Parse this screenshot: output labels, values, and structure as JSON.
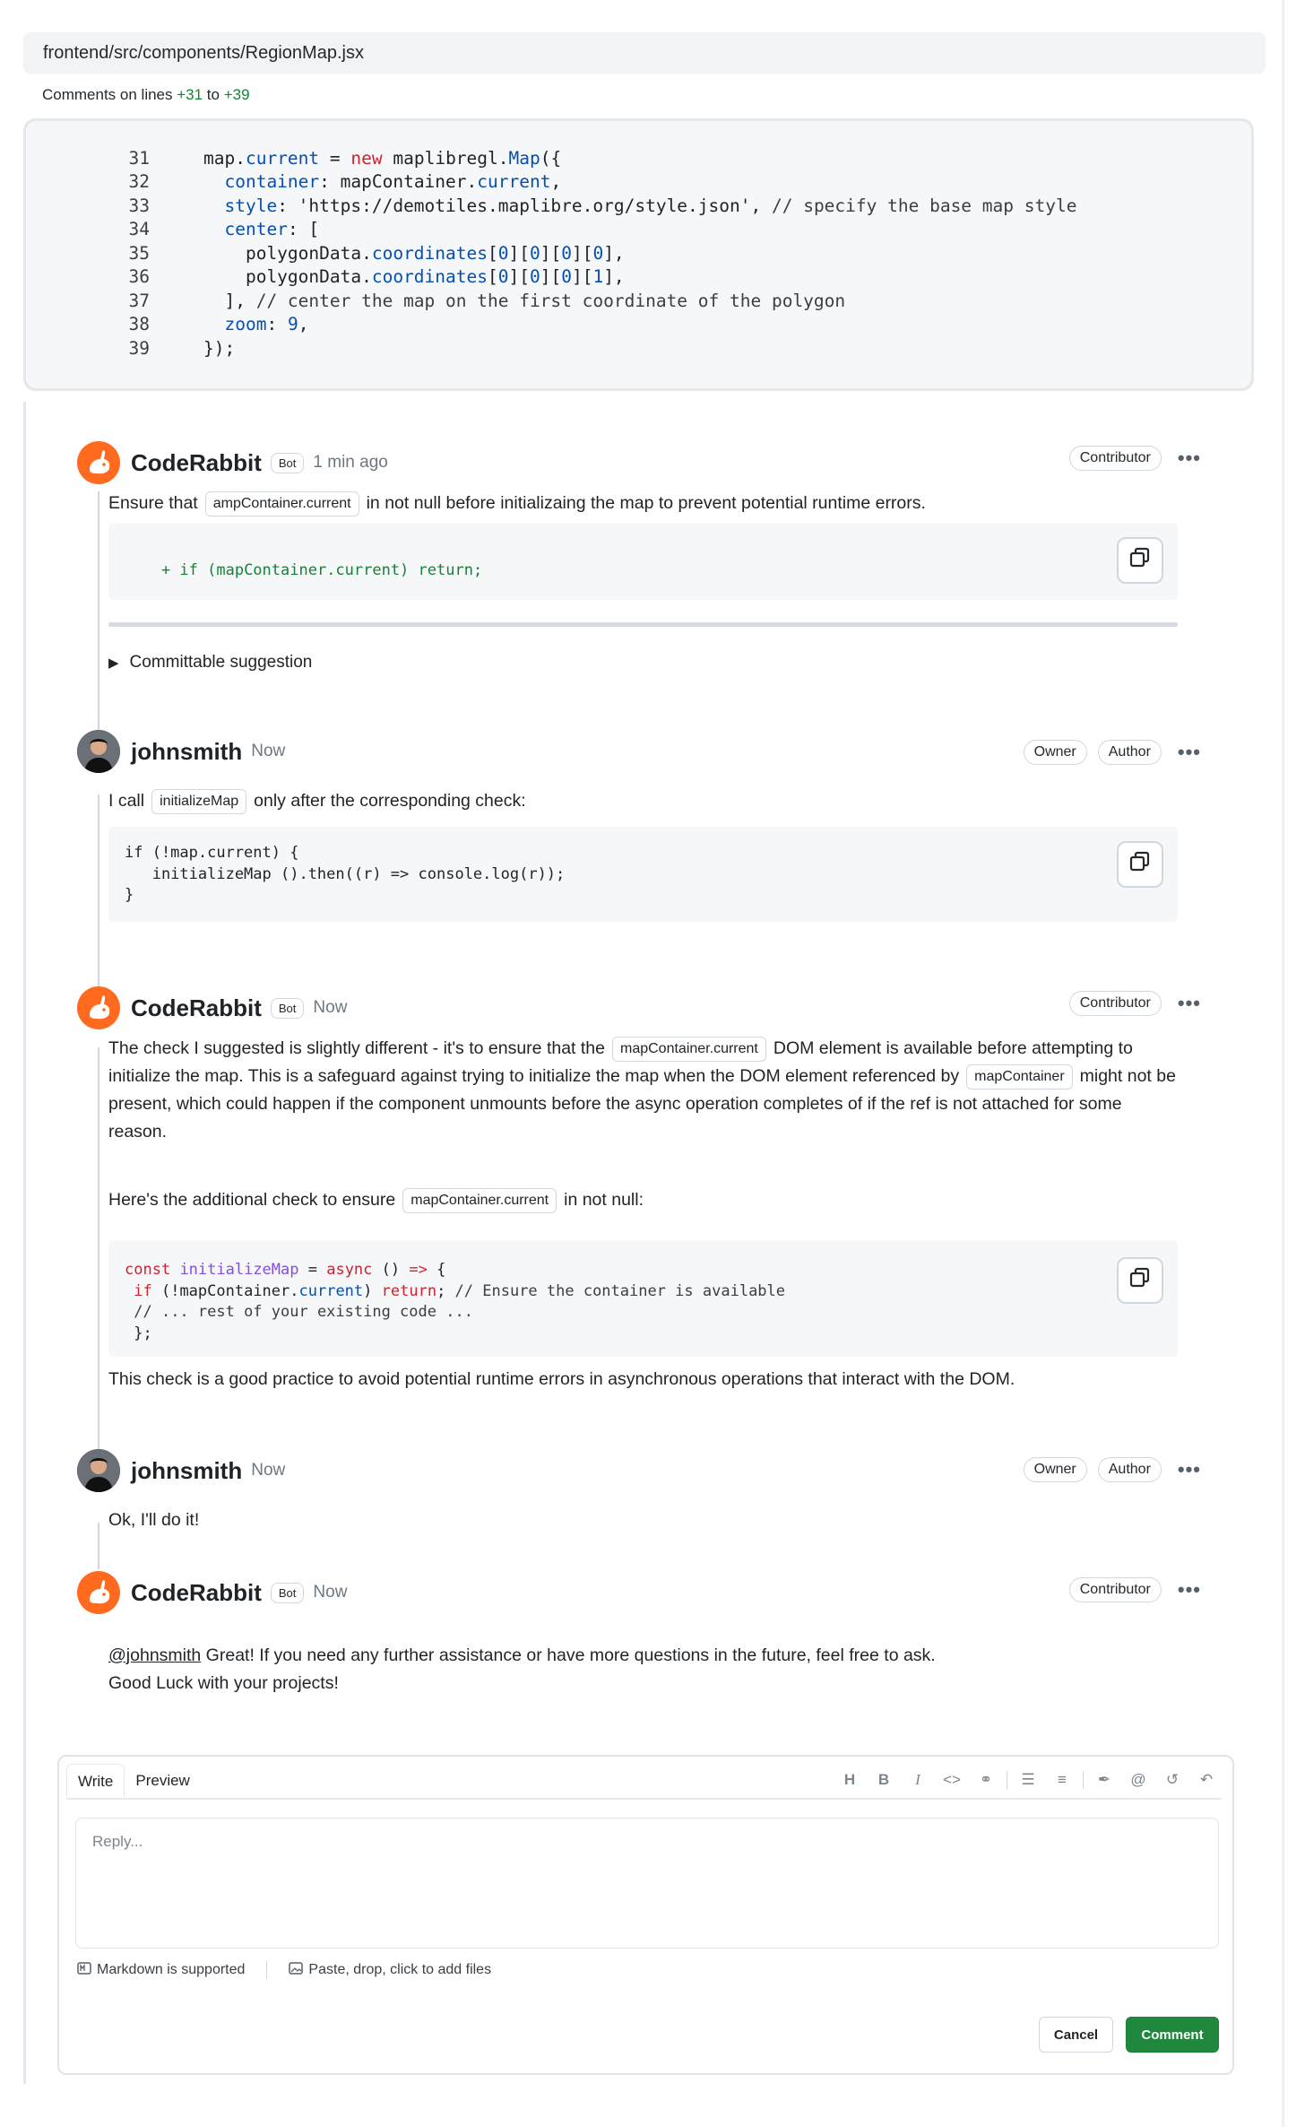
{
  "file": {
    "path": "frontend/src/components/RegionMap.jsx",
    "lines_note_prefix": "Comments on lines ",
    "line_start": "+31",
    "lines_note_mid": " to ",
    "line_end": "+39"
  },
  "code_lines": [
    {
      "n": "31"
    },
    {
      "n": "32"
    },
    {
      "n": "33"
    },
    {
      "n": "34"
    },
    {
      "n": "35"
    },
    {
      "n": "36"
    },
    {
      "n": "37"
    },
    {
      "n": "38"
    },
    {
      "n": "39"
    }
  ],
  "comments": {
    "c1": {
      "author": "CodeRabbit",
      "badge": "Bot",
      "time": "1 min ago",
      "role": "Contributor",
      "text_a": "Ensure that",
      "chip": "ampContainer.current",
      "text_b": "in not null before initializaing the map to prevent potential runtime errors.",
      "suggestion": "+ if (mapContainer.current) return;",
      "details": "Committable suggestion"
    },
    "c2": {
      "author": "johnsmith",
      "time": "Now",
      "role1": "Owner",
      "role2": "Author",
      "text_a": "I call",
      "chip": "initializeMap",
      "text_b": "only after the corresponding check:",
      "code": "if (!map.current) {\n   initializeMap ().then((r) => console.log(r));\n}"
    },
    "c3": {
      "author": "CodeRabbit",
      "badge": "Bot",
      "time": "Now",
      "role": "Contributor",
      "p1_a": "The check I suggested is slightly different - it's to ensure that the",
      "p1_chip1": "mapContainer.current",
      "p1_b": "DOM element is available before attempting to initialize the map. This is a safeguard against trying to initialize the map when the DOM element referenced by",
      "p1_chip2": "mapContainer",
      "p1_c": "might not be present, which could happen if the component unmounts before the async operation completes of if the ref is not attached for some reason.",
      "p2_a": "Here's the additional check to ensure",
      "p2_chip": "mapContainer.current",
      "p2_b": "in not null:",
      "p3": "This check is a good practice to avoid potential runtime errors in asynchronous operations that interact with the DOM."
    },
    "c4": {
      "author": "johnsmith",
      "time": "Now",
      "role1": "Owner",
      "role2": "Author",
      "text": "Ok, I'll do it!"
    },
    "c5": {
      "author": "CodeRabbit",
      "badge": "Bot",
      "time": "Now",
      "role": "Contributor",
      "mention": "@johnsmith",
      "line1": " Great! If you need any further assistance or have more questions in the future, feel free to ask.",
      "line2": "Good Luck with your projects!"
    }
  },
  "reply": {
    "tab_write": "Write",
    "tab_preview": "Preview",
    "placeholder": "Reply...",
    "hint_markdown": "Markdown is supported",
    "hint_files": "Paste, drop, click to add files",
    "cancel": "Cancel",
    "comment": "Comment",
    "toolbar_icons": [
      "heading-icon",
      "bold-icon",
      "italic-icon",
      "code-icon",
      "link-icon",
      "bulleted-list-icon",
      "numbered-list-icon",
      "attach-icon",
      "mention-icon",
      "reference-icon",
      "undo-icon"
    ]
  },
  "colors": {
    "accent_green": "#1f883d",
    "rabbit_orange": "#ff6a1f",
    "diff_green": "#1a7f37"
  }
}
